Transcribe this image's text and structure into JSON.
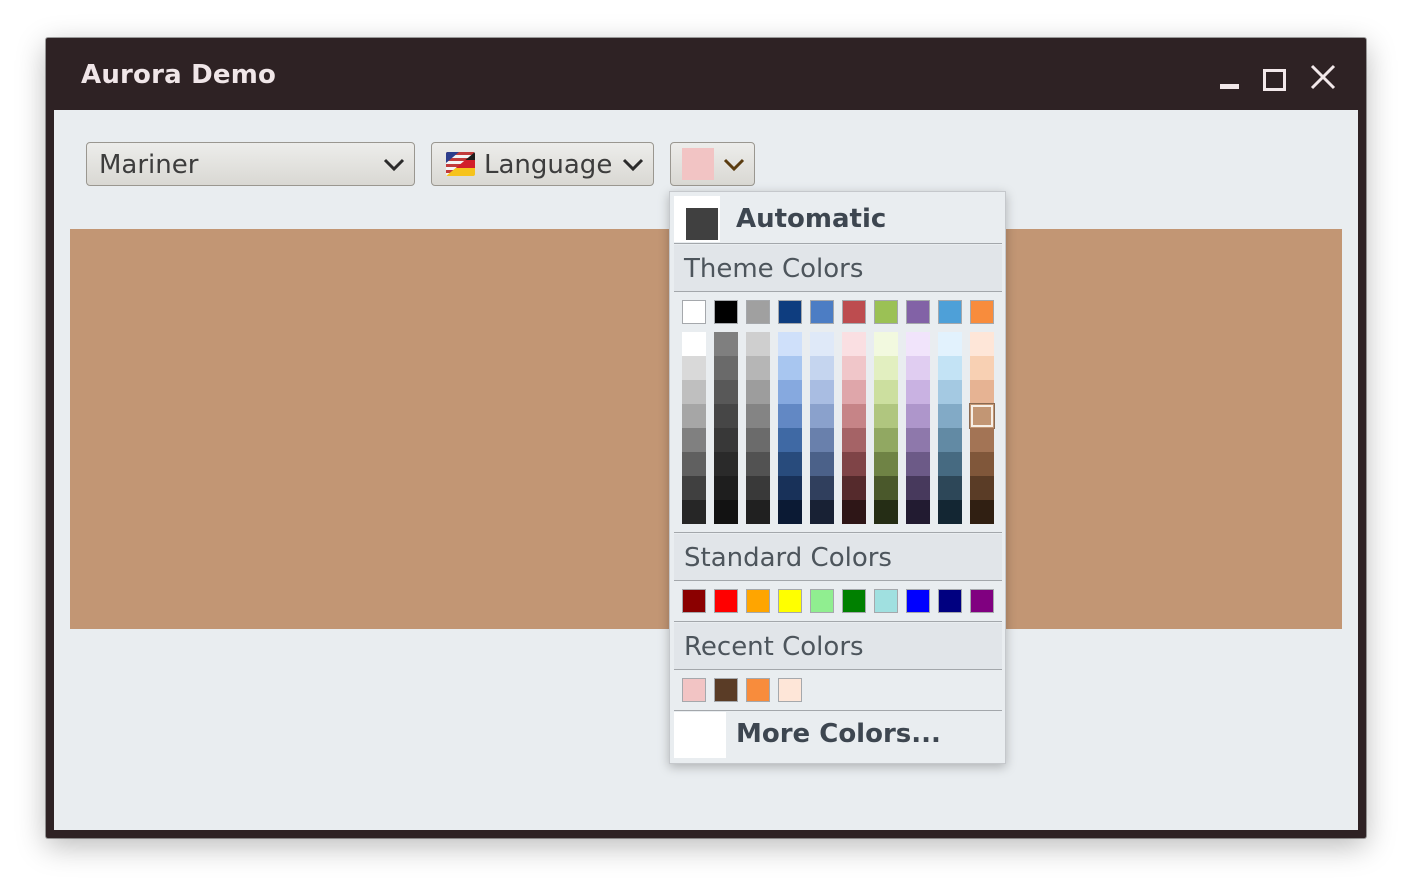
{
  "window": {
    "title": "Aurora Demo",
    "controls": [
      "minimize-icon",
      "maximize-icon",
      "close-icon"
    ],
    "frame_color": "#2e2224",
    "content_background": "#e9edf0"
  },
  "toolbar": {
    "skin_combo": {
      "value": "Mariner"
    },
    "language_combo": {
      "value": "Language",
      "icon": "german-american-flag-icon"
    },
    "color_combo": {
      "value_color": "#f2c4c4"
    }
  },
  "canvas": {
    "fill_color": "#c29674"
  },
  "color_popup": {
    "automatic_label": "Automatic",
    "automatic_color": "#404040",
    "theme_header": "Theme Colors",
    "theme_base": [
      "#ffffff",
      "#000000",
      "#a0a0a0",
      "#0e3d7f",
      "#4c7dc4",
      "#bd4c4f",
      "#9bc155",
      "#8262a6",
      "#4ea0d8",
      "#f88c3c"
    ],
    "theme_shades": [
      [
        "#ffffff",
        "#d9d9d9",
        "#bfbfbf",
        "#a6a6a6",
        "#808080",
        "#606060",
        "#404040",
        "#262626"
      ],
      [
        "#7f7f7f",
        "#6a6a6a",
        "#585858",
        "#464646",
        "#383838",
        "#2a2a2a",
        "#1e1e1e",
        "#121212"
      ],
      [
        "#cfcfcf",
        "#b6b6b6",
        "#9d9d9d",
        "#848484",
        "#6b6b6b",
        "#525252",
        "#393939",
        "#202020"
      ],
      [
        "#cfe0fa",
        "#a8c6f0",
        "#86a9df",
        "#6288c4",
        "#3f69a4",
        "#284b7c",
        "#183159",
        "#0b1a34"
      ],
      [
        "#dfe9f8",
        "#c5d5ef",
        "#a9bde2",
        "#8aa1cc",
        "#6980ac",
        "#4b6189",
        "#303f5d",
        "#182134"
      ],
      [
        "#fadfe2",
        "#f0c6c9",
        "#dfa6aa",
        "#c68487",
        "#a56366",
        "#7f4447",
        "#552a2c",
        "#2e1617"
      ],
      [
        "#f2f9df",
        "#e2efc0",
        "#ccdf9f",
        "#b0c67f",
        "#91a862",
        "#6f8345",
        "#4a582b",
        "#252d15"
      ],
      [
        "#f1e4fb",
        "#e0cdf1",
        "#c9b2e2",
        "#ae96cb",
        "#8e78ab",
        "#6c5a87",
        "#47395c",
        "#221b31"
      ],
      [
        "#e2f2fd",
        "#c3e3f5",
        "#a4c9e2",
        "#82aac6",
        "#628aa4",
        "#466a81",
        "#2d4758",
        "#132633"
      ],
      [
        "#fee6d8",
        "#f8d0b3",
        "#e6b393",
        "#c29674",
        "#a37455",
        "#80573a",
        "#5a3c26",
        "#301f12"
      ]
    ],
    "standard_header": "Standard Colors",
    "standard": [
      "#8b0000",
      "#ff0000",
      "#ffa500",
      "#ffff00",
      "#90ee90",
      "#008000",
      "#a0e0e0",
      "#0000ff",
      "#000080",
      "#800080"
    ],
    "recent_header": "Recent Colors",
    "recent": [
      "#f2c4c4",
      "#5a3c26",
      "#f88c3c",
      "#fee6d8"
    ],
    "more_label": "More Colors..."
  }
}
